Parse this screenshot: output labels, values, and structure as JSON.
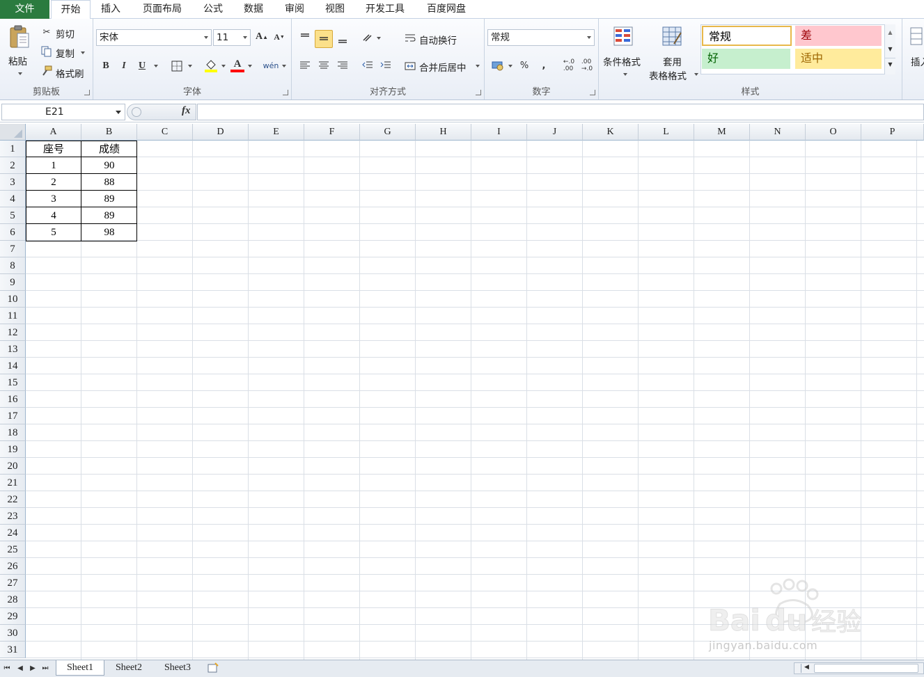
{
  "menu": {
    "file": "文件",
    "tabs": [
      "开始",
      "插入",
      "页面布局",
      "公式",
      "数据",
      "审阅",
      "视图",
      "开发工具",
      "百度网盘"
    ],
    "active_tab": "开始"
  },
  "ribbon": {
    "clipboard": {
      "paste": "粘贴",
      "cut": "剪切",
      "copy": "复制",
      "format_painter": "格式刷",
      "label": "剪贴板"
    },
    "font": {
      "font_name": "宋体",
      "font_size": "11",
      "label": "字体",
      "bold": "B",
      "italic": "I",
      "underline": "U",
      "grow": "A",
      "shrink": "A",
      "font_color_glyph": "A",
      "wen": "wén"
    },
    "alignment": {
      "wrap_text": "自动换行",
      "merge_center": "合并后居中",
      "label": "对齐方式"
    },
    "number": {
      "format": "常规",
      "percent": "%",
      "comma": ",",
      "label": "数字"
    },
    "styles": {
      "conditional": "条件格式",
      "table_format_line1": "套用",
      "table_format_line2": "表格格式",
      "normal": "常规",
      "bad": "差",
      "good": "好",
      "neutral": "适中",
      "label": "样式"
    },
    "insert": "插入"
  },
  "formula_bar": {
    "name_box": "E21",
    "fx": "fx",
    "formula": ""
  },
  "grid": {
    "columns": [
      "A",
      "B",
      "C",
      "D",
      "E",
      "F",
      "G",
      "H",
      "I",
      "J",
      "K",
      "L",
      "M",
      "N",
      "O",
      "P"
    ],
    "rows": [
      "1",
      "2",
      "3",
      "4",
      "5",
      "6",
      "7",
      "8",
      "9",
      "10",
      "11",
      "12",
      "13",
      "14",
      "15",
      "16",
      "17",
      "18",
      "19",
      "20",
      "21",
      "22",
      "23",
      "24",
      "25",
      "26",
      "27",
      "28",
      "29",
      "30",
      "31"
    ],
    "table": {
      "header": [
        "座号",
        "成绩"
      ],
      "data": [
        [
          "1",
          "90"
        ],
        [
          "2",
          "88"
        ],
        [
          "3",
          "89"
        ],
        [
          "4",
          "89"
        ],
        [
          "5",
          "98"
        ]
      ]
    }
  },
  "sheets": {
    "tabs": [
      "Sheet1",
      "Sheet2",
      "Sheet3"
    ],
    "active": "Sheet1"
  },
  "watermark": {
    "brand": "Baidu经验",
    "url": "jingyan.baidu.com"
  },
  "colors": {
    "file_tab": "#2b7b3f",
    "style_bad_bg": "#ffc7ce",
    "style_bad_fg": "#9c0006",
    "style_good_bg": "#c6efce",
    "style_good_fg": "#006100",
    "style_neutral_bg": "#ffeb9c",
    "style_neutral_fg": "#9c6500",
    "highlight_yellow": "#ffff00",
    "font_red": "#ff0000"
  }
}
